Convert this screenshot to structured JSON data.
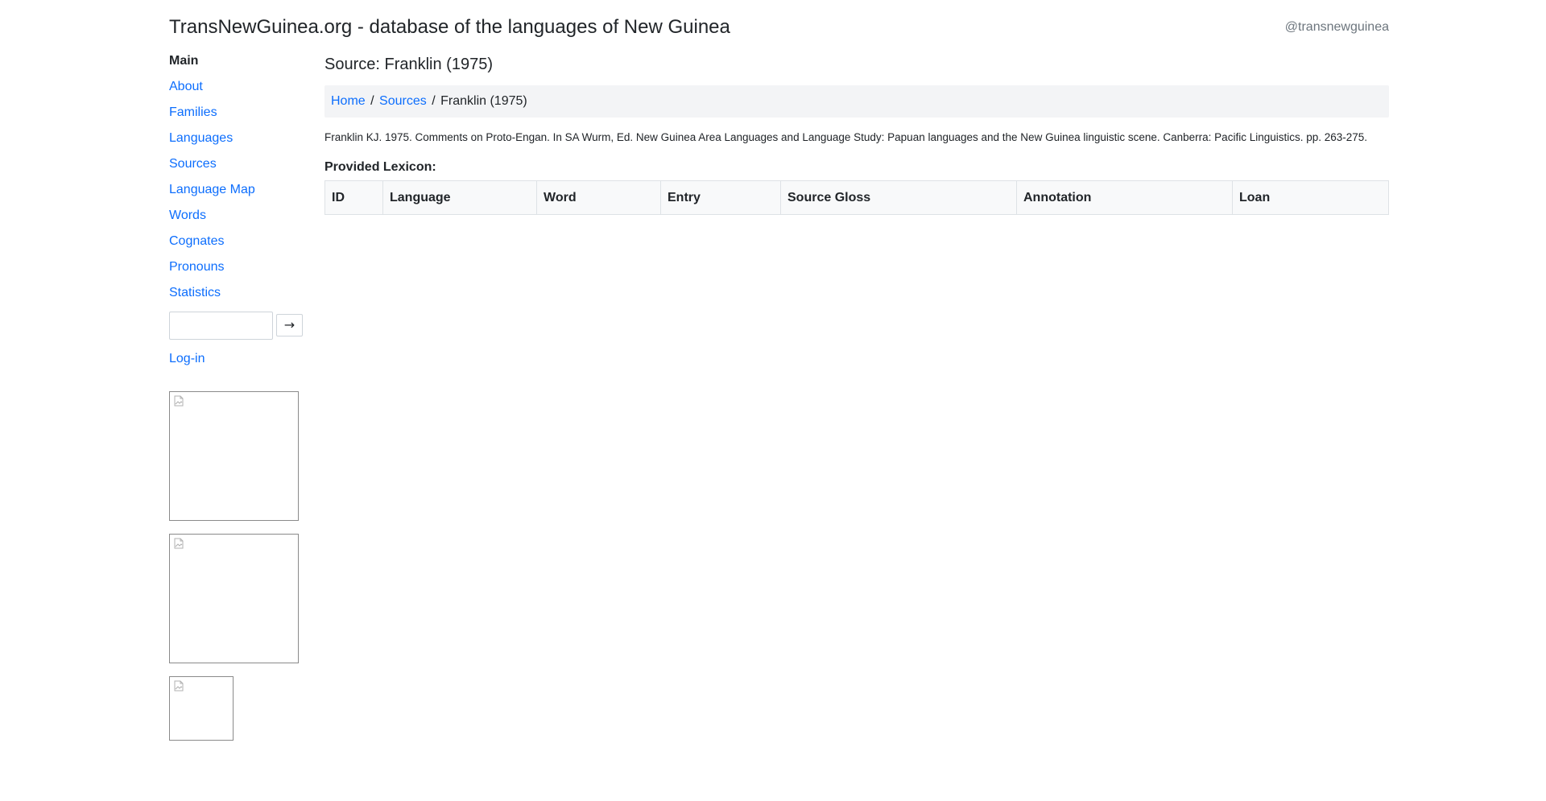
{
  "header": {
    "site_title": "TransNewGuinea.org - database of the languages of New Guinea",
    "twitter_handle": "@transnewguinea"
  },
  "sidebar": {
    "heading": "Main",
    "items": [
      {
        "label": "About"
      },
      {
        "label": "Families"
      },
      {
        "label": "Languages"
      },
      {
        "label": "Sources"
      },
      {
        "label": "Language Map"
      },
      {
        "label": "Words"
      },
      {
        "label": "Cognates"
      },
      {
        "label": "Pronouns"
      },
      {
        "label": "Statistics"
      }
    ],
    "search": {
      "value": "",
      "placeholder": "",
      "button_label": "→"
    },
    "login_label": "Log-in"
  },
  "main": {
    "title": "Source: Franklin (1975)",
    "breadcrumb": {
      "home": "Home",
      "sources": "Sources",
      "current": "Franklin (1975)",
      "separator": "/"
    },
    "reference": "Franklin KJ. 1975. Comments on Proto-Engan. In SA Wurm, Ed. New Guinea Area Languages and Language Study: Papuan languages and the New Guinea linguistic scene. Canberra: Pacific Linguistics. pp. 263-275.",
    "lexicon_heading": "Provided Lexicon:",
    "table": {
      "columns": [
        "ID",
        "Language",
        "Word",
        "Entry",
        "Source Gloss",
        "Annotation",
        "Loan"
      ],
      "rows": []
    }
  },
  "colors": {
    "link": "#0d6efd",
    "text": "#212529",
    "muted": "#6c757d",
    "breadcrumb_bg": "#f3f4f6",
    "table_header_bg": "#f8f9fa"
  },
  "icons": {
    "broken_image": "broken-image-icon",
    "search_submit": "arrow-right-icon"
  }
}
